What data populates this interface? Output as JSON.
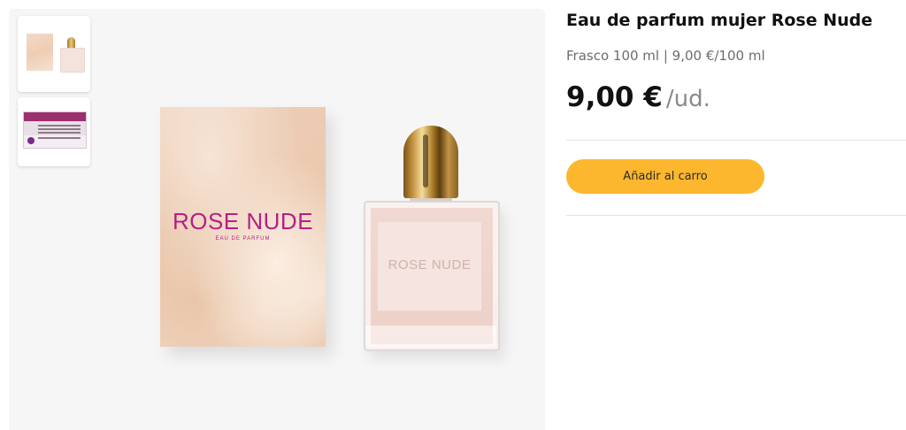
{
  "product": {
    "title": "Eau de parfum mujer Rose Nude",
    "size_info": "Frasco 100 ml | 9,00 €/100 ml",
    "price": "9,00 €",
    "price_unit": "/ud.",
    "add_to_cart_label": "Añadir al carro"
  },
  "image": {
    "box_brand": "ROSE NUDE",
    "box_subtitle": "EAU DE PARFUM",
    "bottle_brand": "ROSE NUDE"
  },
  "thumbnails": [
    {
      "name": "product-front"
    },
    {
      "name": "product-label"
    }
  ],
  "colors": {
    "accent_button": "#fcb72e",
    "brand_text": "#b41f86"
  }
}
